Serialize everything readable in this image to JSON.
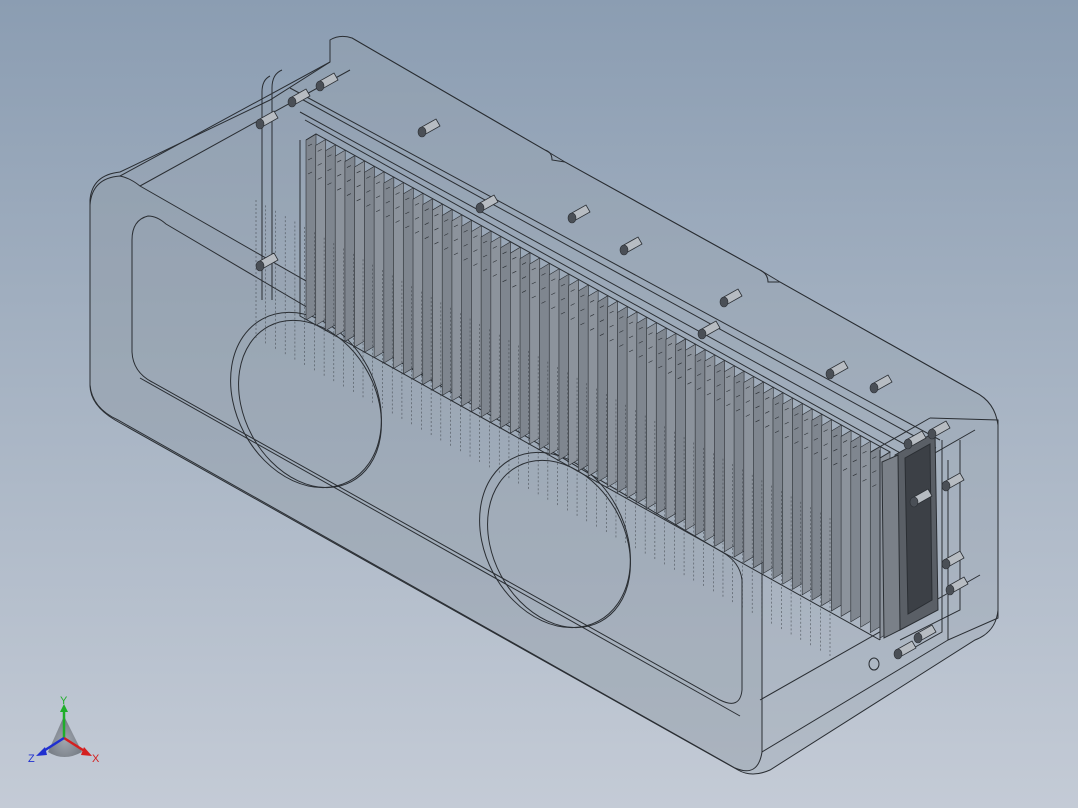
{
  "viewport": {
    "background_top": "#8b9db2",
    "background_bottom": "#c4cbd6"
  },
  "model": {
    "description_icon": "battery-pack-assembly",
    "cell_count": 60,
    "line_color": "#2a2e33",
    "shell_fill": "#a3acb7"
  },
  "triad": {
    "x_label": "X",
    "y_label": "Y",
    "z_label": "Z",
    "x_color": "#d42020",
    "y_color": "#1fae2a",
    "z_color": "#2030d0"
  }
}
